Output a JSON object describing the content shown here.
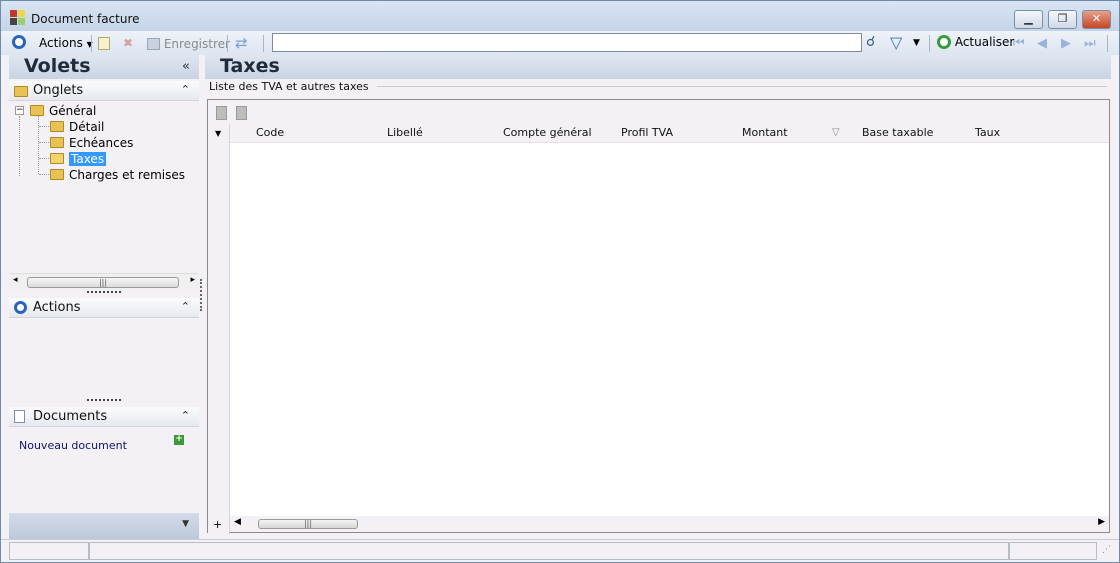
{
  "window": {
    "title": "Document facture",
    "buttons": {
      "minimize": "▁",
      "restore": "❐",
      "close": "✕"
    }
  },
  "toolbar": {
    "actions_label": "Actions",
    "save_label": "Enregistrer",
    "search_value": "",
    "refresh_label": "Actualiser"
  },
  "left_panel": {
    "title": "Volets",
    "onglets": {
      "title": "Onglets",
      "tree": {
        "root": "Général",
        "children": [
          "Détail",
          "Echéances",
          "Taxes",
          "Charges et remises"
        ],
        "selected": "Taxes"
      }
    },
    "actions": {
      "title": "Actions"
    },
    "documents": {
      "title": "Documents",
      "new_document": "Nouveau document"
    }
  },
  "main": {
    "title": "Taxes",
    "group_label": "Liste des TVA et autres taxes",
    "columns": [
      "Code",
      "Libellé",
      "Compte général",
      "Profil TVA",
      "Montant",
      "Base taxable",
      "Taux"
    ],
    "rows": []
  },
  "colors": {
    "selection": "#3399ff",
    "link": "#12126e",
    "header_gradient_top": "#dfe6f0",
    "header_gradient_bottom": "#c9d4e2"
  }
}
